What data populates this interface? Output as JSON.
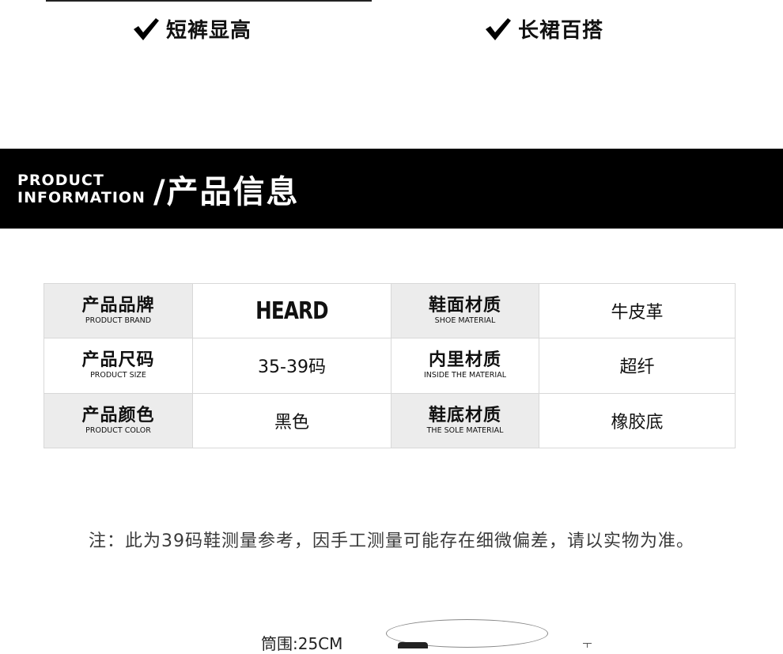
{
  "features": [
    {
      "label": "短裤显高"
    },
    {
      "label": "长裙百搭"
    }
  ],
  "banner": {
    "en_line1": "PRODUCT",
    "en_line2": "INFORMATION",
    "cn": "/产品信息"
  },
  "info_table": {
    "rows": [
      [
        {
          "key_cn": "产品品牌",
          "key_en": "PRODUCT BRAND",
          "value": "HEARD"
        },
        {
          "key_cn": "鞋面材质",
          "key_en": "SHOE MATERIAL",
          "value": "牛皮革"
        }
      ],
      [
        {
          "key_cn": "产品尺码",
          "key_en": "PRODUCT SIZE",
          "value": "35-39码"
        },
        {
          "key_cn": "内里材质",
          "key_en": "INSIDE THE MATERIAL",
          "value": "超纤"
        }
      ],
      [
        {
          "key_cn": "产品颜色",
          "key_en": "PRODUCT COLOR",
          "value": "黑色"
        },
        {
          "key_cn": "鞋底材质",
          "key_en": "THE SOLE MATERIAL",
          "value": "橡胶底"
        }
      ]
    ]
  },
  "note": "注：此为39码鞋测量参考，因手工测量可能存在细微偏差，请以实物为准。",
  "measure_label": "筒围:25CM",
  "colors": {
    "banner_bg": "#000000",
    "key_bg": "#ececec",
    "border": "#d8d8d8"
  },
  "icons": [
    "checkmark-icon",
    "checkmark-icon"
  ]
}
